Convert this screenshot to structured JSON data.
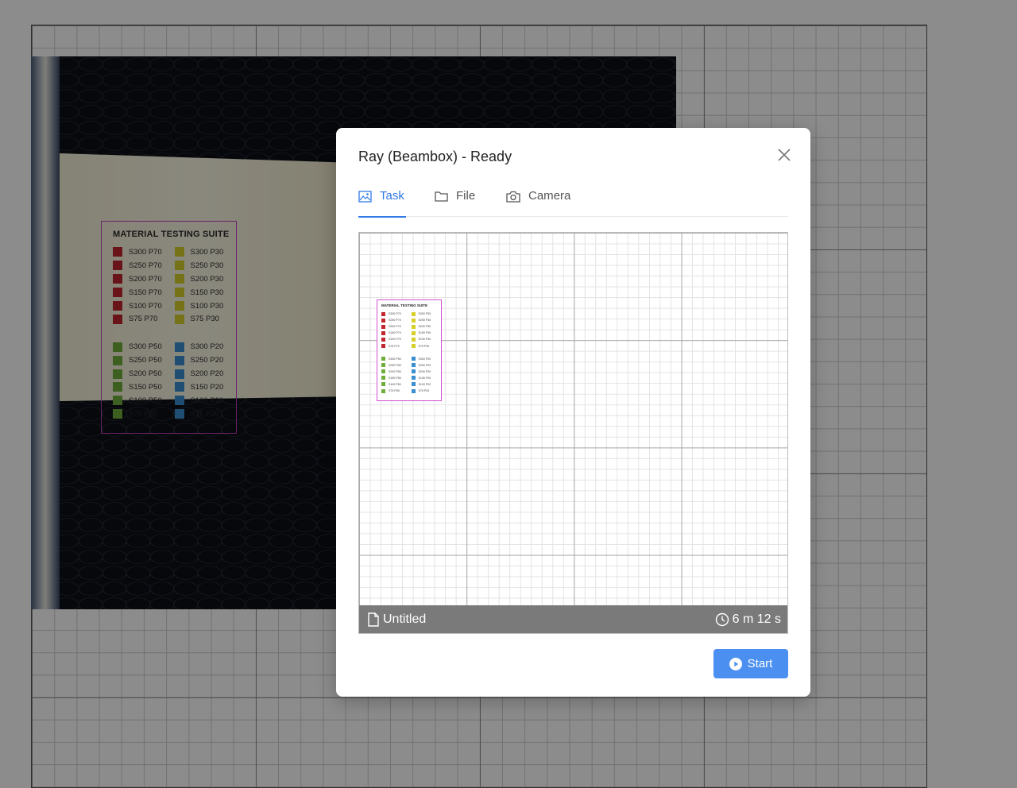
{
  "modal": {
    "title": "Ray (Beambox) - Ready",
    "close_icon": "close-icon",
    "tabs": [
      {
        "label": "Task",
        "icon": "image-icon",
        "active": true
      },
      {
        "label": "File",
        "icon": "folder-icon",
        "active": false
      },
      {
        "label": "Camera",
        "icon": "camera-icon",
        "active": false
      }
    ],
    "preview": {
      "file_name": "Untitled",
      "file_icon": "file-icon",
      "estimated_time": "6 m 12 s",
      "time_icon": "clock-icon"
    },
    "start_label": "Start",
    "start_icon": "play-circle-icon"
  },
  "design": {
    "title": "MATERIAL TESTING SUITE",
    "group_a": {
      "left": {
        "color": "#c0262e",
        "labels": [
          "S300 P70",
          "S250 P70",
          "S200 P70",
          "S150 P70",
          "S100 P70",
          "S75 P70"
        ]
      },
      "right": {
        "color": "#d6cf2a",
        "labels": [
          "S300 P30",
          "S250 P30",
          "S200 P30",
          "S150 P30",
          "S100 P30",
          "S75 P30"
        ]
      }
    },
    "group_b": {
      "left": {
        "color": "#6fae3a",
        "labels": [
          "S300 P50",
          "S250 P50",
          "S200 P50",
          "S150 P50",
          "S100 P50",
          "S75 P50"
        ]
      },
      "right": {
        "color": "#3a8fd0",
        "labels": [
          "S300 P20",
          "S250 P20",
          "S200 P20",
          "S150 P20",
          "S100 P20",
          "S75 P20"
        ]
      }
    }
  },
  "colors": {
    "accent": "#2f7ae5",
    "start_button": "#4b8ff0",
    "design_outline": "#c23cc0"
  }
}
